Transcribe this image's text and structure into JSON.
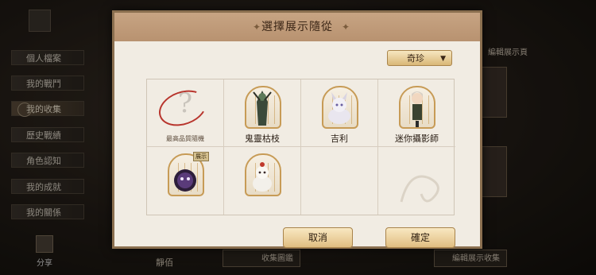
{
  "background": {
    "sidebar": {
      "items": [
        {
          "label": "個人檔案"
        },
        {
          "label": "我的戰鬥"
        },
        {
          "label": "我的收集"
        },
        {
          "label": "歷史戰績"
        },
        {
          "label": "角色認知"
        },
        {
          "label": "我的成就"
        },
        {
          "label": "我的關係"
        }
      ],
      "active_index": 2,
      "share_label": "分享"
    },
    "bottom_left_text": "靜佰",
    "bottom_mid_button": "收集圖鑑",
    "bottom_right_button": "編輯展示收集",
    "right_panel_title": "編輯展示頁"
  },
  "dialog": {
    "title": "選擇展示隨從",
    "filter": {
      "selected": "奇珍"
    },
    "slots": [
      {
        "label": "最高品質隨機",
        "figure": "question-mark",
        "small": true
      },
      {
        "label": "鬼靈枯枝",
        "figure": "dark-tree-spirit"
      },
      {
        "label": "吉利",
        "figure": "white-wolf"
      },
      {
        "label": "迷你攝影師",
        "figure": "photographer"
      },
      {
        "label": "",
        "figure": "purple-creature",
        "badge": "展示"
      },
      {
        "label": "",
        "figure": "white-fox"
      },
      {
        "label": "",
        "figure": "empty"
      },
      {
        "label": "",
        "figure": "empty-decor"
      }
    ],
    "buttons": {
      "cancel": "取消",
      "confirm": "確定"
    }
  },
  "colors": {
    "accent_gold": "#c79b56",
    "header_tan": "#c7a483",
    "ring_red": "#b8352d"
  }
}
